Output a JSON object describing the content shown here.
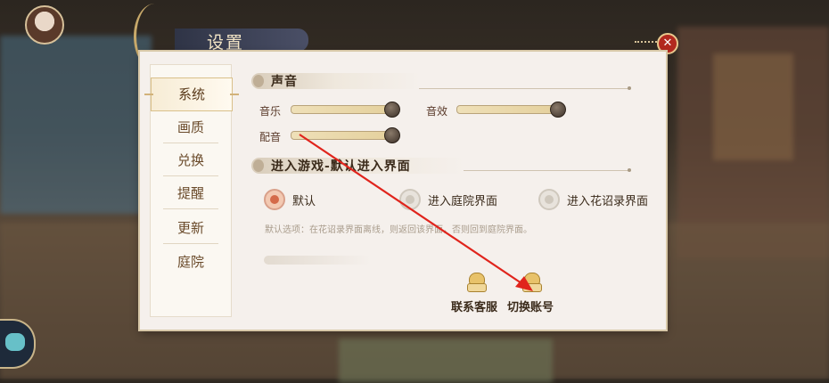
{
  "dialog": {
    "title": "设置",
    "close_glyph": "✕"
  },
  "sidebar": {
    "items": [
      {
        "label": "系统",
        "active": true
      },
      {
        "label": "画质",
        "active": false
      },
      {
        "label": "兑换",
        "active": false
      },
      {
        "label": "提醒",
        "active": false
      },
      {
        "label": "更新",
        "active": false
      },
      {
        "label": "庭院",
        "active": false
      }
    ]
  },
  "sound": {
    "title": "声音",
    "music": {
      "label": "音乐",
      "level": 1.0
    },
    "sfx": {
      "label": "音效",
      "level": 1.0
    },
    "voice": {
      "label": "配音",
      "level": 1.0
    }
  },
  "entry": {
    "title": "进入游戏-默认进入界面",
    "options": [
      {
        "label": "默认",
        "selected": true
      },
      {
        "label": "进入庭院界面",
        "selected": false
      },
      {
        "label": "进入花诏录界面",
        "selected": false
      }
    ],
    "description": "默认选项：在花诏录界面离线，则返回该界面，否则回到庭院界面。"
  },
  "actions": {
    "support_label": "联系客服",
    "switch_account_label": "切换账号"
  },
  "colors": {
    "close_red": "#b2291f",
    "annotation_arrow": "#e0241c",
    "accent_gold": "#c9b07a"
  }
}
